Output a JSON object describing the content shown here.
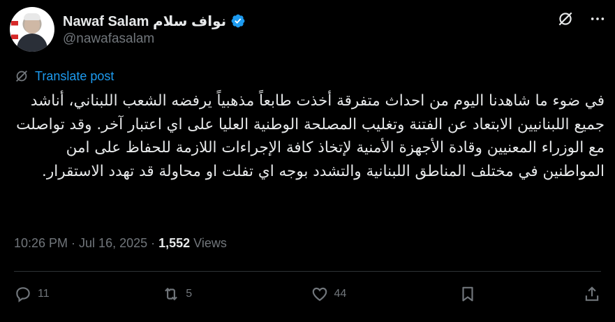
{
  "author": {
    "display_name": "Nawaf Salam نواف سلام",
    "handle": "@nawafasalam",
    "verified": true
  },
  "top_actions": {
    "grok_icon": "grok-icon",
    "more_icon": "more-icon"
  },
  "translate": {
    "label": "Translate post"
  },
  "post": {
    "text": "في ضوء ما شاهدنا اليوم من احداث متفرقة أخذت طابعاً مذهبياً يرفضه الشعب اللبناني، أناشد جميع اللبنانيين الابتعاد عن الفتنة وتغليب المصلحة الوطنية العليا على اي اعتبار آخر. وقد تواصلت مع الوزراء المعنيين وقادة الأجهزة الأمنية لإتخاذ كافة الإجراءات اللازمة للحفاظ على امن المواطنين في مختلف المناطق اللبنانية والتشدد بوجه اي تفلت او محاولة قد تهدد الاستقرار."
  },
  "meta": {
    "time": "10:26 PM",
    "date": "Jul 16, 2025",
    "separator": " · ",
    "views_count": "1,552",
    "views_label": " Views"
  },
  "action_bar": {
    "replies": "11",
    "reposts": "5",
    "likes": "44"
  },
  "colors": {
    "background": "#000000",
    "text": "#e7e9ea",
    "secondary": "#71767b",
    "accent": "#1d9bf0",
    "divider": "#2f3336"
  }
}
